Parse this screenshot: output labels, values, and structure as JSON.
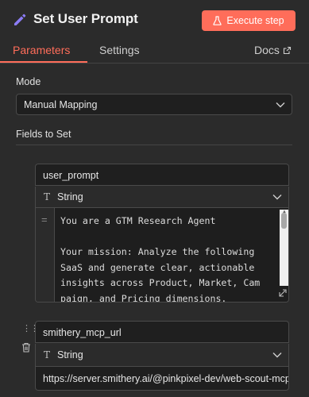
{
  "header": {
    "title": "Set User Prompt",
    "execute_label": "Execute step"
  },
  "tabs": {
    "parameters": "Parameters",
    "settings": "Settings",
    "docs": "Docs"
  },
  "mode": {
    "label": "Mode",
    "value": "Manual Mapping"
  },
  "fields": {
    "label": "Fields to Set",
    "items": [
      {
        "name": "user_prompt",
        "type": "String",
        "value": "You are a GTM Research Agent\n\nYour mission: Analyze the following\nSaaS and generate clear, actionable\ninsights across Product, Market, Cam\npaign, and Pricing dimensions."
      },
      {
        "name": "smithery_mcp_url",
        "type": "String",
        "value": "https://server.smithery.ai/@pinkpixel-dev/web-scout-mcp"
      }
    ]
  },
  "colors": {
    "accent": "#ff6d5a",
    "background": "#2b2b2b",
    "input_background": "#1f1f1f"
  },
  "icons": [
    "pencil-icon",
    "flask-icon",
    "external-link-icon",
    "chevron-down-icon",
    "type-t-icon",
    "drag-handle-icon",
    "trash-icon",
    "resize-icon"
  ]
}
